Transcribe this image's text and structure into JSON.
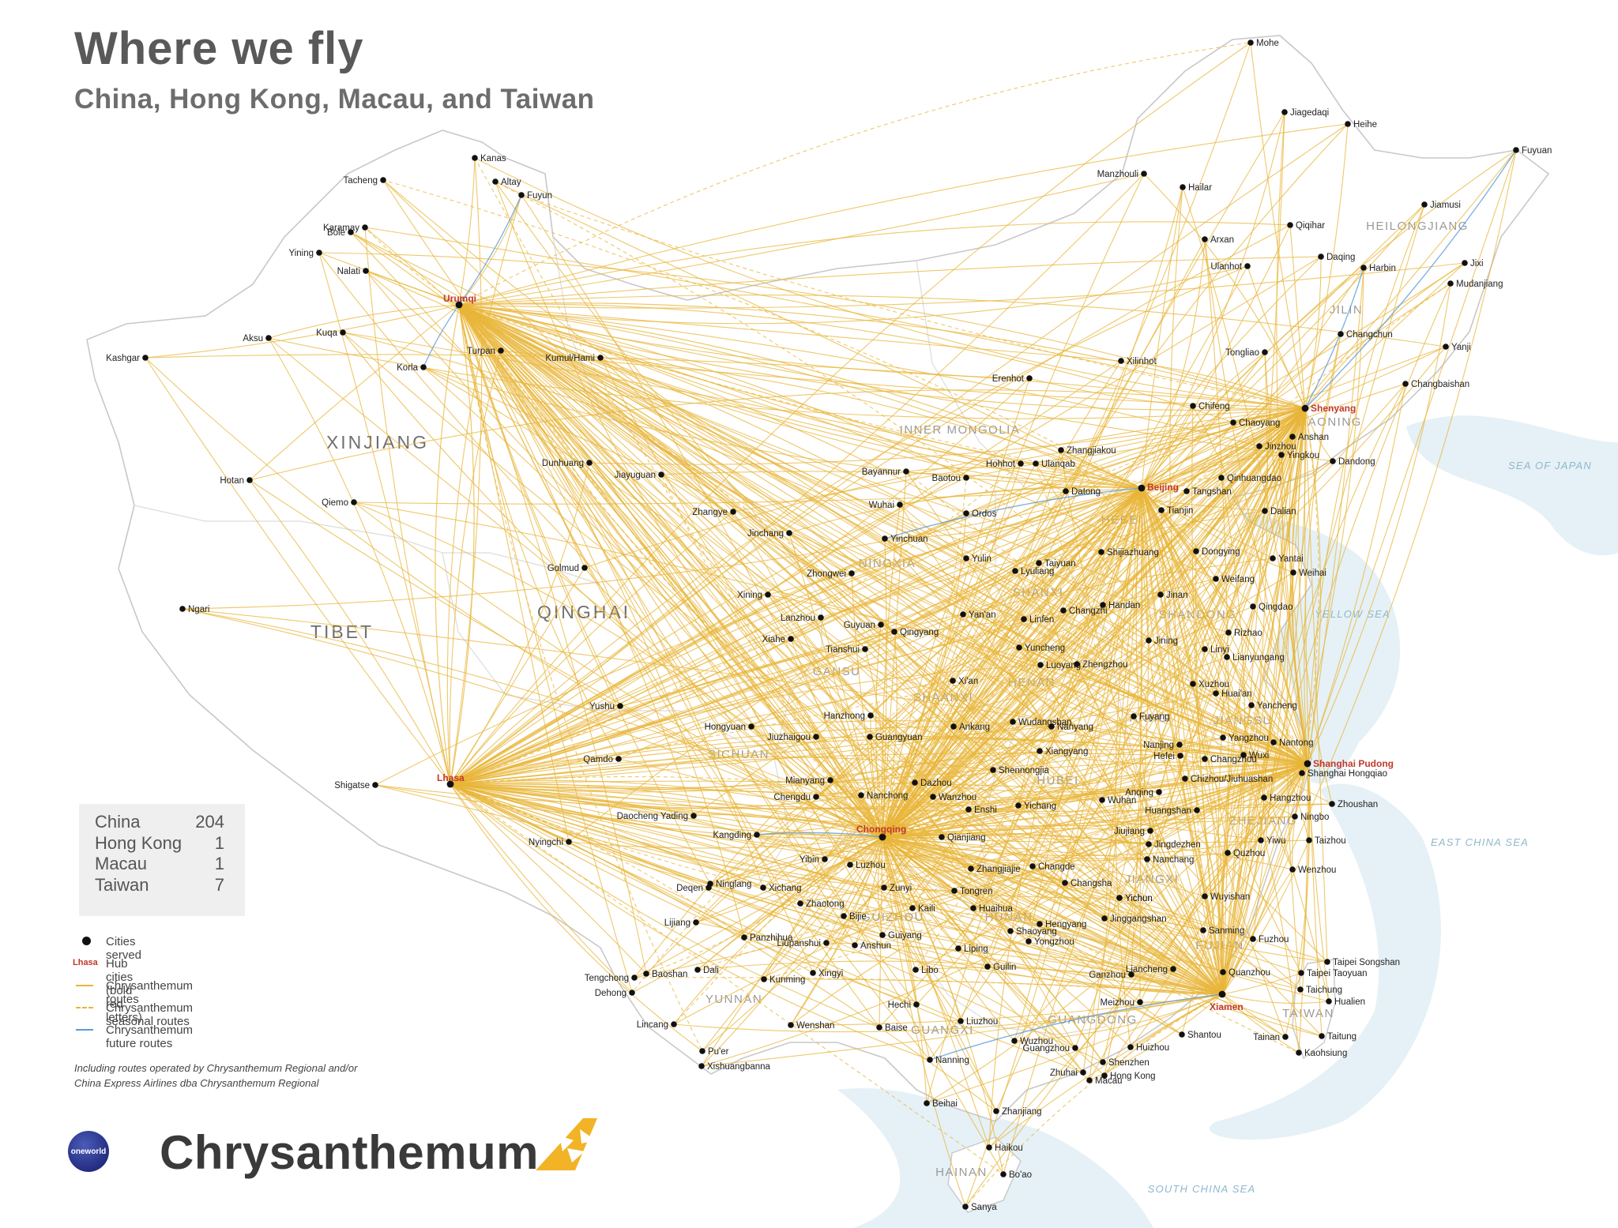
{
  "title": "Where we fly",
  "subtitle": "China, Hong Kong, Macau, and Taiwan",
  "counts": [
    {
      "label": "China",
      "value": "204"
    },
    {
      "label": "Hong Kong",
      "value": "1"
    },
    {
      "label": "Macau",
      "value": "1"
    },
    {
      "label": "Taiwan",
      "value": "7"
    }
  ],
  "legend": {
    "cities": "Cities served",
    "hub_sample": "Lhasa",
    "hubs": "Hub cities (bold red letters)",
    "routes": "Chrysanthemum routes",
    "seasonal": "Chrysanthemum seasonal routes",
    "future": "Chrysanthemum future routes"
  },
  "footnote": [
    "Including routes operated by Chrysanthemum Regional and/or",
    "China Express Airlines dba Chrysanthemum Regional"
  ],
  "brand": "Chrysanthemum",
  "alliance": "oneworld",
  "colors": {
    "route": "#e8b53a",
    "future": "#5a9ad6",
    "hub": "#c0392b",
    "sea": "#cfe6ef",
    "border": "#c8c8c8"
  },
  "regions": [
    {
      "name": "XINJIANG",
      "big": true
    },
    {
      "name": "TIBET",
      "big": true
    },
    {
      "name": "QINGHAI",
      "big": true
    },
    {
      "name": "INNER MONGOLIA"
    },
    {
      "name": "HEILONGJIANG"
    },
    {
      "name": "JILIN"
    },
    {
      "name": "LIAONING"
    },
    {
      "name": "HEBEI"
    },
    {
      "name": "NINGXIA"
    },
    {
      "name": "SHANXI"
    },
    {
      "name": "SHANDONG"
    },
    {
      "name": "GANSU"
    },
    {
      "name": "SHAANXI"
    },
    {
      "name": "HENAN"
    },
    {
      "name": "ANHUI"
    },
    {
      "name": "JIANGSU"
    },
    {
      "name": "SICHUAN"
    },
    {
      "name": "HUBEI"
    },
    {
      "name": "ZHEJIANG"
    },
    {
      "name": "JIANGXI"
    },
    {
      "name": "GUIZHOU"
    },
    {
      "name": "HUNAN"
    },
    {
      "name": "FUJIAN"
    },
    {
      "name": "YUNNAN"
    },
    {
      "name": "GUANGXI"
    },
    {
      "name": "GUANGDONG"
    },
    {
      "name": "TAIWAN"
    },
    {
      "name": "HAINAN"
    }
  ],
  "seas": [
    "SEA OF JAPAN",
    "YELLOW SEA",
    "EAST CHINA SEA",
    "SOUTH CHINA SEA"
  ],
  "hubs": [
    "Urumqi",
    "Beijing",
    "Shenyang",
    "Shanghai Pudong",
    "Chongqing",
    "Xiamen",
    "Lhasa"
  ],
  "cities": [
    "Mohe",
    "Jiagedaqi",
    "Heihe",
    "Fuyuan",
    "Manzhouli",
    "Hailar",
    "Yichun",
    "Jiamusi",
    "Qiqihar",
    "Arxan",
    "Daqing",
    "Harbin",
    "Jixi",
    "Mudanjiang",
    "Ulanhot",
    "Changchun",
    "Yanji",
    "Tongliao",
    "Xilinhot",
    "Changbaishan",
    "Erenhot",
    "Chifeng",
    "Chaoyang",
    "Anshan",
    "Jinzhou",
    "Yingkou",
    "Dandong",
    "Zhangjiakou",
    "Hohhot",
    "Ulanqab",
    "Baotou",
    "Bayannur",
    "Datong",
    "Qinhuangdao",
    "Tangshan",
    "Tianjin",
    "Dalian",
    "Wuhai",
    "Ordos",
    "Yinchuan",
    "Yulin",
    "Taiyuan",
    "Shijiazhuang",
    "Dongying",
    "Yantai",
    "Weihai",
    "Weifang",
    "Lyuliang",
    "Zhongwei",
    "Xining",
    "Lanzhou",
    "Guyuan",
    "Qingyang",
    "Yan'an",
    "Changzhi",
    "Handan",
    "Jinan",
    "Qingdao",
    "Linfen",
    "Xiahe",
    "Tianshui",
    "Yuncheng",
    "Jining",
    "Linyi",
    "Rizhao",
    "Lianyungang",
    "Luoyang",
    "Zhengzhou",
    "Xi'an",
    "Xuzhou",
    "Huai'an",
    "Yancheng",
    "Fuyang",
    "Hanzhong",
    "Ankang",
    "Wudangshan",
    "Nanyang",
    "Nanjing",
    "Yangzhou",
    "Nantong",
    "Changzhou",
    "Wuxi",
    "Hefei",
    "Shanghai Hongqiao",
    "Jiuzhaigou",
    "Guangyuan",
    "Xiangyang",
    "Mianyang",
    "Shennongjia",
    "Chizhou/Jiuhuashan",
    "Anqing",
    "Hangzhou",
    "Zhoushan",
    "Chengdu",
    "Nanchong",
    "Dazhou",
    "Wanzhou",
    "Yichang",
    "Wuhan",
    "Huangshan",
    "Ningbo",
    "Enshi",
    "Qianjiang",
    "Jiujiang",
    "Yiwu",
    "Taizhou",
    "Jingdezhen",
    "Quzhou",
    "Nanchang",
    "Wenzhou",
    "Yibin",
    "Luzhou",
    "Zhangjiajie",
    "Changde",
    "Changsha",
    "Zunyi",
    "Tongren",
    "Yichun",
    "Wuyishan",
    "Xichang",
    "Zhaotong",
    "Kaili",
    "Huaihua",
    "Hengyang",
    "Jinggangshan",
    "Sanming",
    "Bijie",
    "Guiyang",
    "Liupanshui",
    "Anshun",
    "Liping",
    "Shaoyang",
    "Yongzhou",
    "Fuzhou",
    "Kunming",
    "Xingyi",
    "Libo",
    "Guilin",
    "Ganzhou",
    "Liancheng",
    "Quanzhou",
    "Taipei Songshan",
    "Taipei Taoyuan",
    "Taichung",
    "Hualien",
    "Hechi",
    "Meizhou",
    "Shantou",
    "Tainan",
    "Taitung",
    "Kaohsiung",
    "Liuzhou",
    "Wuzhou",
    "Baise",
    "Wenshan",
    "Guangzhou",
    "Huizhou",
    "Shenzhen",
    "Hong Kong",
    "Zhuhai",
    "Macau",
    "Nanning",
    "Beihai",
    "Zhanjiang",
    "Haikou",
    "Bo'ao",
    "Sanya",
    "Kanas",
    "Altay",
    "Fuyun",
    "Tacheng",
    "Karamay",
    "Bole",
    "Yining",
    "Nalati",
    "Aksu",
    "Kuqa",
    "Turpan",
    "Kumul/Hami",
    "Kashgar",
    "Korla",
    "Hotan",
    "Qiemo",
    "Dunhuang",
    "Jiayuguan",
    "Zhangye",
    "Jinchang",
    "Golmud",
    "Ngari",
    "Yushu",
    "Hongyuan",
    "Qamdo",
    "Shigatse",
    "Daocheng Yading",
    "Kangding",
    "Nyingchi",
    "Deqen",
    "Ninglang",
    "Lijiang",
    "Panzhihua",
    "Tengchong",
    "Baoshan",
    "Dali",
    "Dehong",
    "Lincang",
    "Pu'er",
    "Xishuangbanna"
  ]
}
